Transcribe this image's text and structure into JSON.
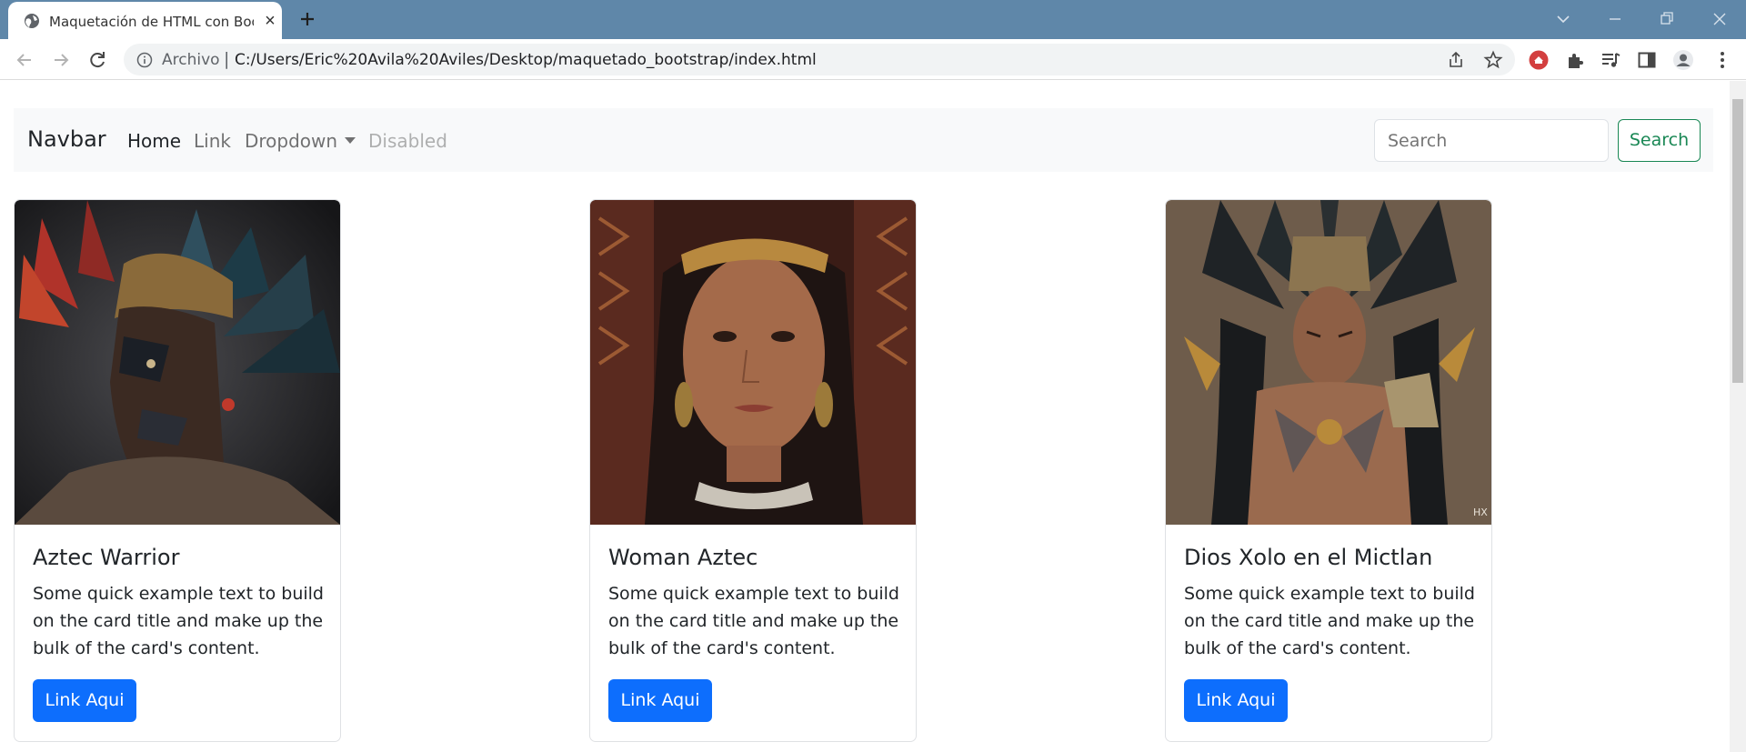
{
  "browser": {
    "tab_title": "Maquetación de HTML con Bootstrap",
    "scheme_label": "Archivo",
    "separator": "|",
    "url": "C:/Users/Eric%20Avila%20Aviles/Desktop/maquetado_bootstrap/index.html"
  },
  "navbar": {
    "brand": "Navbar",
    "links": {
      "home": "Home",
      "link": "Link",
      "dropdown": "Dropdown",
      "disabled": "Disabled"
    },
    "search_placeholder": "Search",
    "search_button": "Search"
  },
  "cards": [
    {
      "title": "Aztec Warrior",
      "text": "Some quick example text to build on the card title and make up the bulk of the card's content.",
      "button": "Link Aqui"
    },
    {
      "title": "Woman Aztec",
      "text": "Some quick example text to build on the card title and make up the bulk of the card's content.",
      "button": "Link Aqui"
    },
    {
      "title": "Dios Xolo en el Mictlan",
      "text": "Some quick example text to build on the card title and make up the bulk of the card's content.",
      "button": "Link Aqui",
      "watermark": "HX"
    }
  ],
  "colors": {
    "tabbar": "#5f87a9",
    "primary_button": "#0d6efd",
    "success_outline": "#198754",
    "navbar_bg": "#f8f9fa"
  }
}
